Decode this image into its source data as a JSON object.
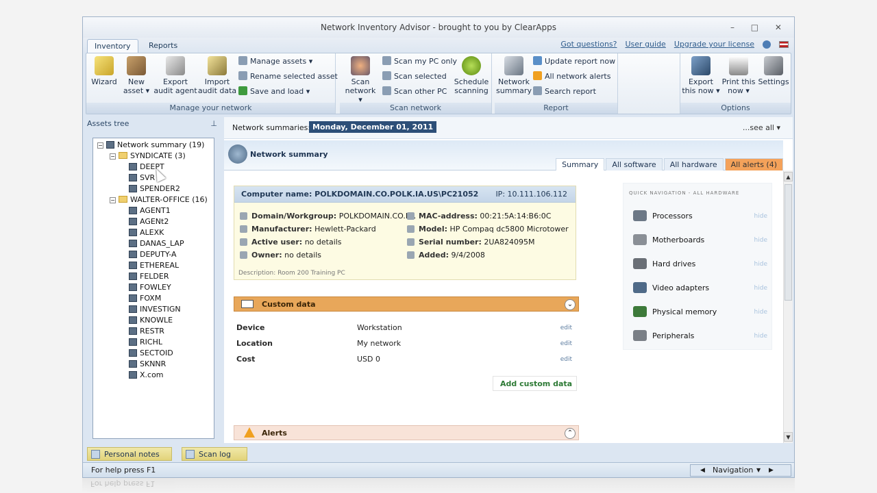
{
  "window": {
    "title": "Network Inventory Advisor - brought to you by ClearApps",
    "controls": "– □ ✕"
  },
  "ribbon_tabs": [
    "Inventory",
    "Reports"
  ],
  "top_links": [
    "Got questions?",
    "User guide",
    "Upgrade your license"
  ],
  "ribbon": {
    "wizard": "Wizard",
    "new_asset": [
      "New",
      "asset ▾"
    ],
    "export_agent": [
      "Export",
      "audit agent"
    ],
    "import_audit": [
      "Import",
      "audit data"
    ],
    "manage_assets": "Manage assets ▾",
    "rename_asset": "Rename selected asset",
    "save_load": "Save and load ▾",
    "group_manage": "Manage your network",
    "scan_network": [
      "Scan",
      "network ▾"
    ],
    "scan_my_pc": "Scan my PC only",
    "scan_selected": "Scan selected",
    "scan_other": "Scan other PC",
    "schedule": [
      "Schedule",
      "scanning"
    ],
    "group_scan": "Scan network",
    "network_summary": [
      "Network",
      "summary"
    ],
    "update_report": "Update report now",
    "all_alerts": "All network alerts",
    "search_report": "Search report",
    "group_report": "Report",
    "export_now": [
      "Export",
      "this now ▾"
    ],
    "print_now": [
      "Print this",
      "now ▾"
    ],
    "settings": "Settings",
    "group_options": "Options"
  },
  "sidebar": {
    "title": "Assets tree",
    "pin": "⊥",
    "tree": {
      "root": "Network summary (19)",
      "groups": [
        {
          "name": "SYNDICATE (3)",
          "items": [
            "DEEPT",
            "SVR",
            "SPENDER2"
          ]
        },
        {
          "name": "WALTER-OFFICE (16)",
          "items": [
            "AGENT1",
            "AGENt2",
            "ALEXK",
            "DANAS_LAP",
            "DEPUTY-A",
            "ETHEREAL",
            "FELDER",
            "FOWLEY",
            "FOXM",
            "INVESTIGN",
            "KNOWLE",
            "RESTR",
            "RICHL",
            "SECTOID",
            "SKNNR",
            "X.com"
          ]
        }
      ]
    }
  },
  "main": {
    "summaries_label": "Network summaries:",
    "date": "Monday, December 01, 2011",
    "see_all": "...see all ▾",
    "banner_title": "Network summary",
    "tabs": [
      "Summary",
      "All software",
      "All hardware",
      "All alerts (4)"
    ],
    "computer": {
      "name": "Computer name: POLKDOMAIN.CO.POLK.IA.US\\PC21052",
      "ip": "IP: 10.111.106.112",
      "left": [
        {
          "k": "Domain/Workgroup:",
          "v": "POLKDOMAIN.CO.P..."
        },
        {
          "k": "Manufacturer:",
          "v": "Hewlett-Packard"
        },
        {
          "k": "Active user:",
          "v": "no details"
        },
        {
          "k": "Owner:",
          "v": "no details"
        }
      ],
      "right": [
        {
          "k": "MAC-address:",
          "v": "00:21:5A:14:B6:0C"
        },
        {
          "k": "Model:",
          "v": "HP Compaq dc5800 Microtower"
        },
        {
          "k": "Serial number:",
          "v": "2UA824095M"
        },
        {
          "k": "Added:",
          "v": "9/4/2008"
        }
      ],
      "description": "Description: Room 200 Training PC"
    },
    "custom_data": {
      "title": "Custom data",
      "rows": [
        {
          "k": "Device",
          "v": "Workstation",
          "e": "edit"
        },
        {
          "k": "Location",
          "v": "My network",
          "e": "edit"
        },
        {
          "k": "Cost",
          "v": "USD 0",
          "e": "edit"
        }
      ],
      "add": "Add custom data"
    },
    "alerts_title": "Alerts",
    "quick_nav": {
      "title": "QUICK NAVIGATION - ALL HARDWARE",
      "items": [
        "Processors",
        "Motherboards",
        "Hard drives",
        "Video adapters",
        "Physical memory",
        "Peripherals"
      ],
      "hide": "hide"
    }
  },
  "bottom_tabs": [
    "Personal notes",
    "Scan log"
  ],
  "status": {
    "text": "For help press F1",
    "nav": "Navigation"
  }
}
